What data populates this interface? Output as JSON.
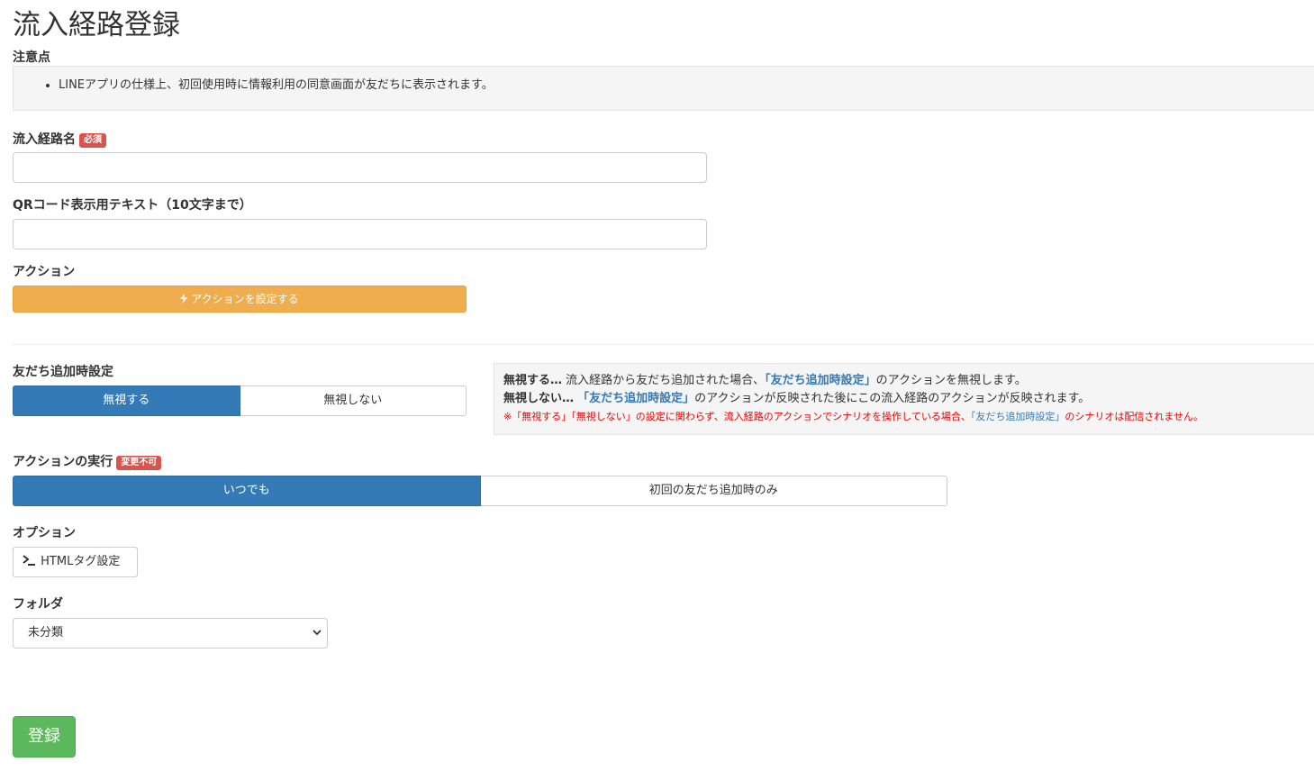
{
  "page": {
    "title": "流入経路登録"
  },
  "notice": {
    "label": "注意点",
    "items": [
      "LINEアプリの仕様上、初回使用時に情報利用の同意画面が友だちに表示されます。"
    ]
  },
  "route_name": {
    "label": "流入経路名",
    "badge": "必須",
    "value": ""
  },
  "qr_text": {
    "label": "QRコード表示用テキスト（10文字まで）",
    "value": ""
  },
  "action": {
    "label": "アクション",
    "button_label": "アクションを設定する",
    "icon": "bolt-icon"
  },
  "friend_add": {
    "label": "友だち追加時設定",
    "options": [
      "無視する",
      "無視しない"
    ],
    "selected": "無視する",
    "info": {
      "line1_term": "無視する…",
      "line1_a": " 流入経路から友だち追加された場合、",
      "line1_link": "「友だち追加時設定」",
      "line1_b": "のアクションを無視します。",
      "line2_term": "無視しない…",
      "line2_link": "「友だち追加時設定」",
      "line2_b": "のアクションが反映された後にこの流入経路のアクションが反映されます。",
      "warn_a": "※「無視する」「無視しない」の設定に関わらず、流入経路のアクションでシナリオを操作している場合、",
      "warn_link": "「友だち追加時設定」",
      "warn_b": "のシナリオは配信されません。"
    }
  },
  "execute": {
    "label": "アクションの実行",
    "badge": "変更不可",
    "options": [
      "いつでも",
      "初回の友だち追加時のみ"
    ],
    "selected": "いつでも"
  },
  "option": {
    "label": "オプション",
    "html_button": "HTMLタグ設定",
    "icon": "terminal-icon"
  },
  "folder": {
    "label": "フォルダ",
    "selected": "未分類"
  },
  "submit": {
    "label": "登録"
  },
  "colors": {
    "primary": "#337ab7",
    "warning": "#f0ad4e",
    "success": "#5cb85c",
    "danger": "#d9534f"
  }
}
